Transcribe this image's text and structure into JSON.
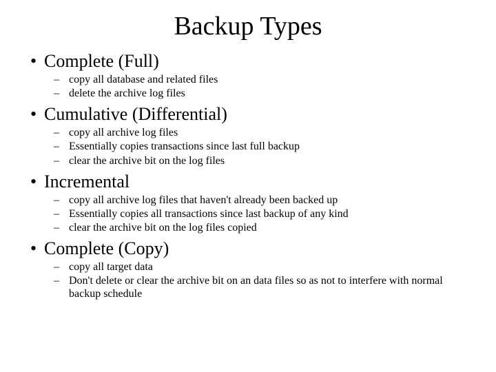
{
  "title": "Backup Types",
  "sections": [
    {
      "heading": "Complete (Full)",
      "items": [
        "copy all database and related files",
        "delete the archive log files"
      ]
    },
    {
      "heading": "Cumulative (Differential)",
      "items": [
        "copy all archive log files",
        "Essentially copies transactions since last full backup",
        "clear the archive bit on the log files"
      ]
    },
    {
      "heading": "Incremental",
      "items": [
        "copy all archive log files that haven't already been backed up",
        "Essentially copies all transactions since last backup of any kind",
        "clear the archive bit on the log files copied"
      ]
    },
    {
      "heading": "Complete (Copy)",
      "items": [
        "copy all target data",
        "Don't delete or clear the archive bit on an data files so as not to interfere with normal backup schedule"
      ]
    }
  ]
}
